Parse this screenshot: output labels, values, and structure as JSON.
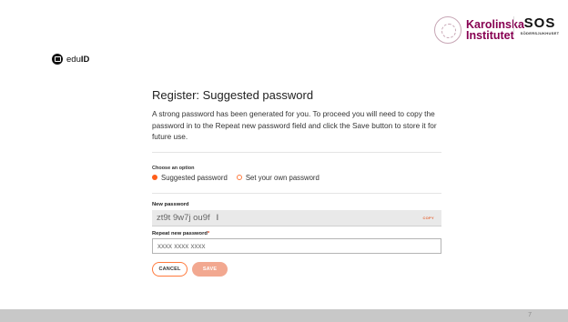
{
  "logos": {
    "ki_line1": "Karolinska",
    "ki_line2": "Institutet",
    "sos_mark": "SOS",
    "sos_sub": "SÖDERSJUKHUSET",
    "eduid_prefix": "edu",
    "eduid_suffix": "ID"
  },
  "form": {
    "title": "Register: Suggested password",
    "intro": "A strong password has been generated for you. To proceed you will need to copy the password in to the Repeat new password field and click the Save button to store it for future use.",
    "choose_label": "Choose an option",
    "options": [
      {
        "label": "Suggested password",
        "selected": true
      },
      {
        "label": "Set your own password",
        "selected": false
      }
    ],
    "new_password_label": "New password",
    "new_password_value": "zt9t 9w7j ou9f",
    "copy_label": "COPY",
    "repeat_label": "Repeat new password",
    "repeat_required": "*",
    "repeat_placeholder": "xxxx xxxx xxxx",
    "repeat_value": "",
    "cancel_label": "CANCEL",
    "save_label": "SAVE"
  },
  "slide_number": "7",
  "colors": {
    "accent": "#ff5e1a",
    "ki_brand": "#870052",
    "save_disabled": "#f2a890",
    "bottom_bar": "#c8c8c8"
  },
  "icons": {
    "eduid_logo": "lock-badge-icon",
    "radio_on": "radio-selected-icon",
    "radio_off": "radio-unselected-icon",
    "text_cursor": "text-cursor-icon"
  }
}
